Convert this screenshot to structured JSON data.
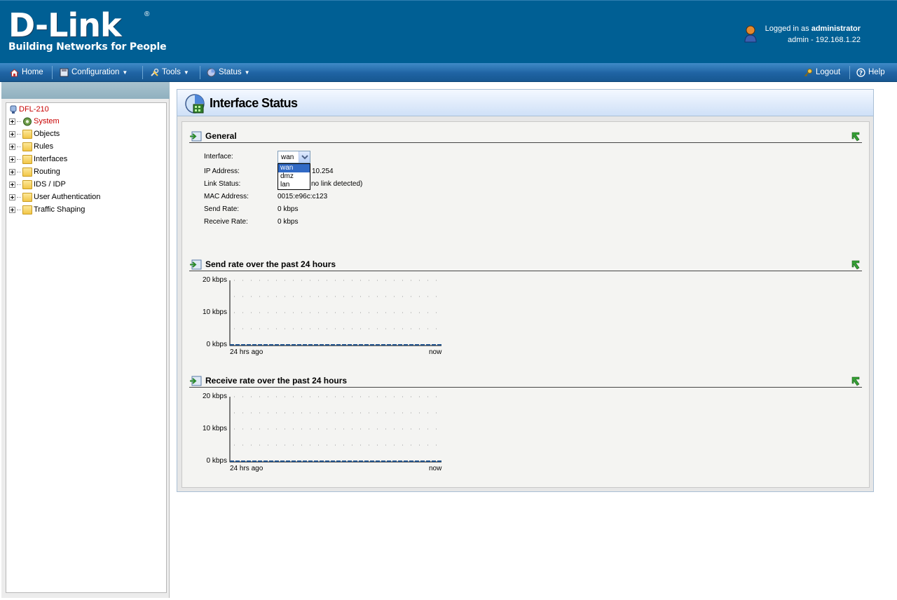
{
  "header": {
    "logo": "D-Link",
    "logo_reg": "®",
    "tagline": "Building Networks for People",
    "logged_in_prefix": "Logged in as ",
    "logged_in_user": "administrator",
    "session": "admin - 192.168.1.22"
  },
  "menubar": {
    "home": "Home",
    "configuration": "Configuration",
    "tools": "Tools",
    "status": "Status",
    "logout": "Logout",
    "help": "Help"
  },
  "tree": {
    "root": "DFL-210",
    "items": [
      {
        "label": "System",
        "icon": "system-gear-icon"
      },
      {
        "label": "Objects",
        "icon": "folder-icon"
      },
      {
        "label": "Rules",
        "icon": "rules-folder-icon"
      },
      {
        "label": "Interfaces",
        "icon": "interfaces-folder-icon"
      },
      {
        "label": "Routing",
        "icon": "routing-folder-icon"
      },
      {
        "label": "IDS / IDP",
        "icon": "idp-folder-icon"
      },
      {
        "label": "User Authentication",
        "icon": "user-auth-folder-icon"
      },
      {
        "label": "Traffic Shaping",
        "icon": "traffic-shaping-folder-icon"
      }
    ]
  },
  "page": {
    "title": "Interface Status"
  },
  "general": {
    "heading": "General",
    "interface_label": "Interface:",
    "interface_value": "wan",
    "interface_options": [
      "wan",
      "dmz",
      "lan"
    ],
    "ip_label": "IP Address:",
    "ip_value": "10.254",
    "link_label": "Link Status:",
    "link_value": "no link detected)",
    "mac_label": "MAC Address:",
    "mac_value": "0015:e96c:c123",
    "send_label": "Send Rate:",
    "send_value": "0 kbps",
    "recv_label": "Receive Rate:",
    "recv_value": "0 kbps"
  },
  "send_section": {
    "heading": "Send rate over the past 24 hours"
  },
  "recv_section": {
    "heading": "Receive rate over the past 24 hours"
  },
  "chart_data": [
    {
      "type": "line",
      "title": "Send rate over the past 24 hours",
      "categories": [
        "24 hrs ago",
        "now"
      ],
      "x": [
        0,
        24
      ],
      "values": [
        0,
        0
      ],
      "yticks": [
        "20 kbps",
        "10 kbps",
        "0 kbps"
      ],
      "xticks": [
        "24 hrs ago",
        "now"
      ],
      "ylim": [
        0,
        20
      ],
      "grid": true,
      "color": "#1c4f8a"
    },
    {
      "type": "line",
      "title": "Receive rate over the past 24 hours",
      "categories": [
        "24 hrs ago",
        "now"
      ],
      "x": [
        0,
        24
      ],
      "values": [
        0,
        0
      ],
      "yticks": [
        "20 kbps",
        "10 kbps",
        "0 kbps"
      ],
      "xticks": [
        "24 hrs ago",
        "now"
      ],
      "ylim": [
        0,
        20
      ],
      "grid": true,
      "color": "#1c4f8a"
    }
  ]
}
